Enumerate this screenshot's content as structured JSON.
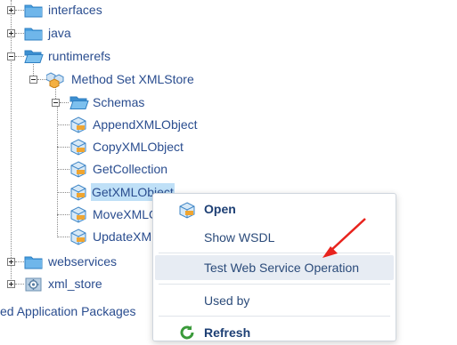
{
  "tree": {
    "nodes": [
      {
        "label": "interfaces",
        "icon": "folder-icon",
        "expander": "plus"
      },
      {
        "label": "java",
        "icon": "folder-icon",
        "expander": "plus"
      },
      {
        "label": "runtimerefs",
        "icon": "folder-open-icon",
        "expander": "minus"
      },
      {
        "label": "Method Set XMLStore",
        "icon": "method-set-icon",
        "expander": "minus"
      },
      {
        "label": "Schemas",
        "icon": "folder-open-icon",
        "expander": "minus"
      },
      {
        "label": "AppendXMLObject",
        "icon": "operation-icon"
      },
      {
        "label": "CopyXMLObject",
        "icon": "operation-icon"
      },
      {
        "label": "GetCollection",
        "icon": "operation-icon"
      },
      {
        "label": "GetXMLObject",
        "icon": "operation-icon",
        "selected": true
      },
      {
        "label": "MoveXMLO",
        "icon": "operation-icon"
      },
      {
        "label": "UpdateXML",
        "icon": "operation-icon"
      },
      {
        "label": "webservices",
        "icon": "folder-icon",
        "expander": "plus"
      },
      {
        "label": "xml_store",
        "icon": "package-gear-icon",
        "expander": "plus"
      }
    ],
    "footer_label": "ed Application Packages"
  },
  "context_menu": {
    "items": [
      {
        "label": "Open",
        "icon": "operation-icon",
        "bold": true
      },
      {
        "label": "Show WSDL"
      },
      {
        "label": "Test Web Service Operation",
        "highlighted": true
      },
      {
        "label": "Used by"
      },
      {
        "label": "Refresh",
        "icon": "refresh-icon"
      }
    ]
  },
  "annotation": {
    "type": "red-arrow",
    "color": "#e8231d",
    "points_to": "Test Web Service Operation"
  },
  "colors": {
    "link_text": "#2a4d8f",
    "selection": "#bfe0f7",
    "menu_highlight": "#e7ecf3",
    "folder": "#3c93d6"
  }
}
